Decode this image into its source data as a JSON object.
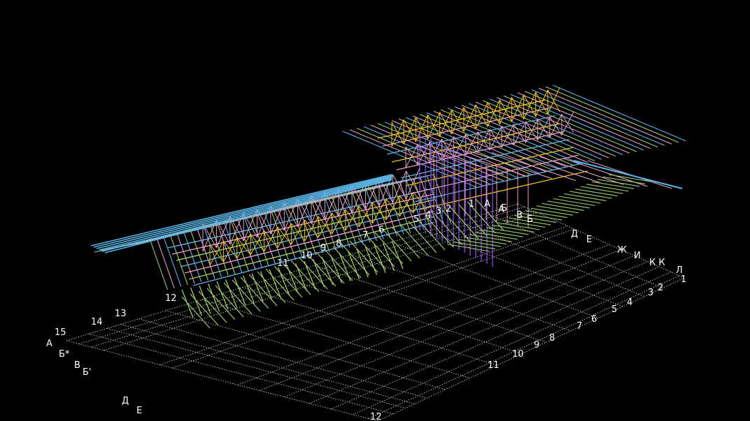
{
  "colors": {
    "background": "#000000",
    "grid": "#dddddd",
    "label": "#ffffff",
    "beam_blue": "#5ab4e6",
    "beam_green": "#9ccc6a",
    "beam_pink": "#e3a0c8",
    "beam_yellow": "#f2c21a",
    "column_violet": "#9a55e8"
  },
  "axis_labels": {
    "front_letters": [
      "А",
      "Б*",
      "В",
      "Б'",
      "Д",
      "Е"
    ],
    "front_numbers": [
      "15",
      "14",
      "13",
      "12"
    ],
    "right_letters": [
      "Д",
      "Е",
      "Ж",
      "И",
      "К К",
      "Л"
    ],
    "right_numbers": [
      "1",
      "2",
      "3",
      "4",
      "5",
      "6",
      "7",
      "8",
      "9",
      "10",
      "11",
      "12"
    ],
    "structure_numbers": [
      "11",
      "10",
      "9",
      "8",
      "7",
      "6",
      "5",
      "4",
      "3",
      "2",
      "1"
    ],
    "structure_letters": [
      "А",
      "А",
      "Б",
      "В",
      "Б"
    ]
  }
}
